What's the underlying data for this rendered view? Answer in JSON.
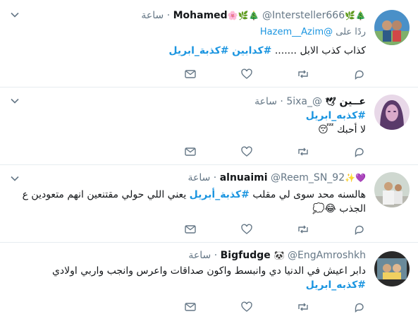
{
  "colors": {
    "link": "#1b95e0",
    "muted": "#657786",
    "text": "#14171a",
    "divider": "#e6ecf0"
  },
  "tweets": [
    {
      "name": "Mohamed",
      "name_emojis_before": "🎄🌿",
      "name_emojis_after": "🌸🌿🎄",
      "handle": "@Intersteller666",
      "sep": "·",
      "time": "ساعة",
      "reply_label": "ردًا على",
      "reply_handle": "@Hazem__Azim",
      "text": "كذاب كذب الابل ....... ",
      "hashtags": [
        "#كدابين",
        "#كذبة_ابريل"
      ]
    },
    {
      "name": "عــين",
      "name_emojis_after": "🕊",
      "handle": "@_5ixa",
      "sep": "·",
      "time": "ساعة",
      "hashtag_line": "#كذبه_ابريل",
      "text": "لا أحبك",
      "text_emoji": "😴"
    },
    {
      "name": "alnuaimi",
      "name_emojis_before": "💜✨",
      "handle": "@Reem_SN_92",
      "sep": "·",
      "time": "ساعة",
      "text_a": "هالسنه محد سوى لي مقلب ",
      "hashtag": "#كذبة_أبريل",
      "text_b": " يعني اللي حولي مقتنعين انهم متعودين ع الجذب",
      "text_emoji": "😂💭"
    },
    {
      "name": "Bigfudge",
      "name_emojis_after": "🐼",
      "handle": "@EngAmroshkh",
      "sep": "·",
      "time": "ساعة",
      "text": "دابر اعيش في الدنيا دي وانبسط واكون صداقات واعرس وانجب واربي اولادي",
      "hashtag_line": "#كذبه_ابريل"
    }
  ]
}
